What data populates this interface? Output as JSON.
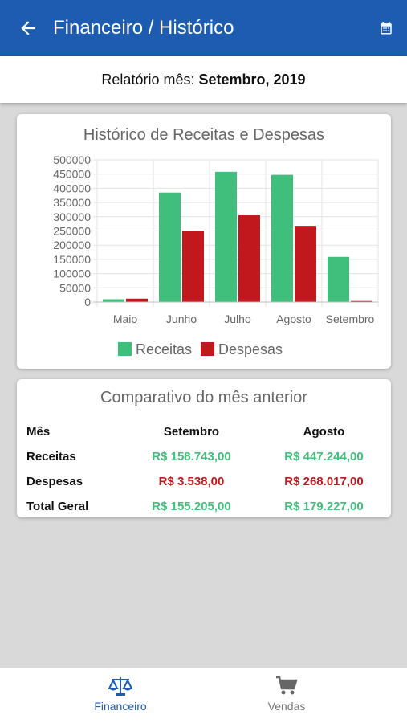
{
  "appbar": {
    "title": "Financeiro / Histórico",
    "back_icon": "arrow-left-icon",
    "calendar_icon": "calendar-icon"
  },
  "report": {
    "label": "Relatório mês:",
    "value": "Setembro, 2019"
  },
  "colors": {
    "primary": "#1d5cb0",
    "receitas": "#3fbf7b",
    "despesas": "#c0181c"
  },
  "chart_data": {
    "type": "bar",
    "title": "Histórico de Receitas e Despesas",
    "categories": [
      "Maio",
      "Junho",
      "Julho",
      "Agosto",
      "Setembro"
    ],
    "series": [
      {
        "name": "Receitas",
        "values": [
          10000,
          385000,
          458000,
          447244,
          158743
        ]
      },
      {
        "name": "Despesas",
        "values": [
          12000,
          250000,
          305000,
          268017,
          3538
        ]
      }
    ],
    "ylim": [
      0,
      500000
    ],
    "yticks": [
      "500000",
      "450000",
      "400000",
      "350000",
      "300000",
      "250000",
      "200000",
      "150000",
      "100000",
      "50000",
      "0"
    ],
    "grid": true,
    "legend": "bottom"
  },
  "comparison": {
    "title": "Comparativo do mês anterior",
    "headers": [
      "Mês",
      "Setembro",
      "Agosto"
    ],
    "rows": [
      {
        "label": "Receitas",
        "current": "R$ 158.743,00",
        "previous": "R$ 447.244,00"
      },
      {
        "label": "Despesas",
        "current": "R$ 3.538,00",
        "previous": "R$ 268.017,00"
      },
      {
        "label": "Total Geral",
        "current": "R$ 155.205,00",
        "previous": "R$ 179.227,00"
      }
    ]
  },
  "nav": {
    "financeiro": {
      "label": "Financeiro",
      "icon": "balance-scale-icon"
    },
    "vendas": {
      "label": "Vendas",
      "icon": "cart-icon"
    }
  }
}
